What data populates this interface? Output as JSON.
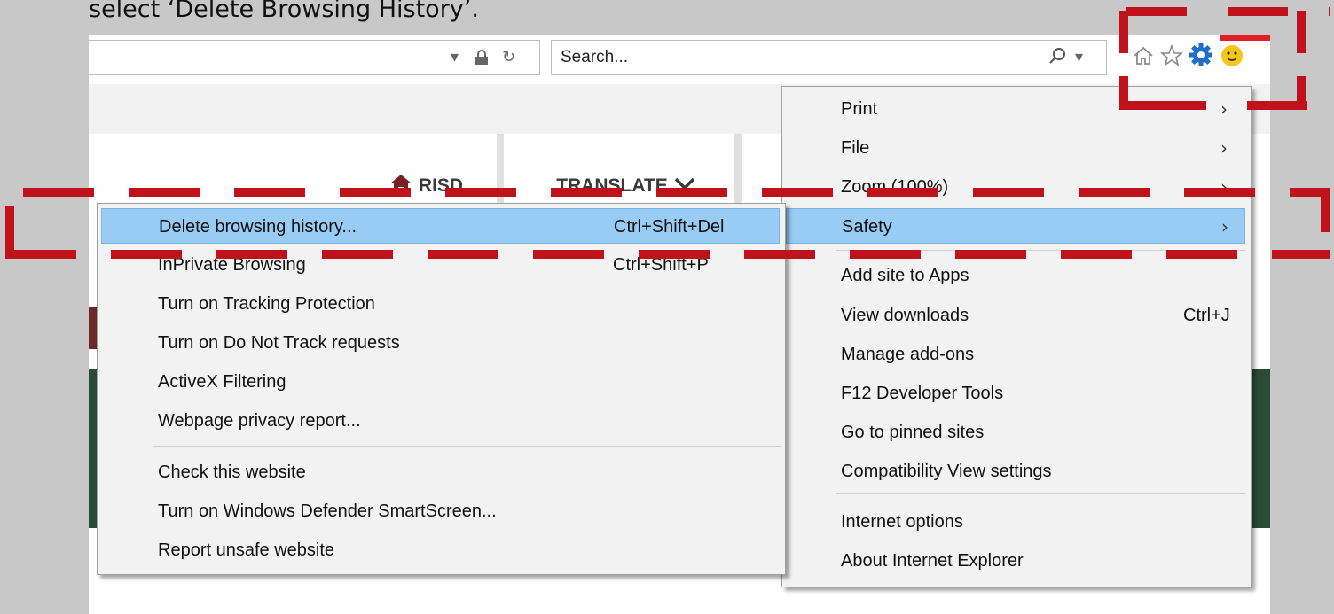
{
  "caption": "select ‘Delete Browsing History’.",
  "address_bar": {
    "dropdown_glyph": "▾",
    "lock_glyph": "🔒",
    "refresh_glyph": "↻"
  },
  "search": {
    "placeholder": "Search...",
    "search_glyph": "⌕",
    "dropdown_glyph": "▾"
  },
  "toolbar_icons": {
    "home": "home-icon",
    "favorites": "star-icon",
    "tools": "gear-icon",
    "feedback": "smiley-icon"
  },
  "site_nav": {
    "home_label": "RISD",
    "translate_label": "TRANSLATE"
  },
  "tools_menu": {
    "items": [
      {
        "label": "Print",
        "shortcut": "",
        "submenu": true
      },
      {
        "label": "File",
        "shortcut": "",
        "submenu": true
      },
      {
        "label": "Zoom (100%)",
        "shortcut": "",
        "submenu": true
      },
      {
        "label": "Safety",
        "shortcut": "",
        "submenu": true,
        "highlighted": true
      },
      {
        "label": "Add site to Apps",
        "shortcut": "",
        "submenu": false
      },
      {
        "label": "View downloads",
        "shortcut": "Ctrl+J",
        "submenu": false
      },
      {
        "label": "Manage add-ons",
        "shortcut": "",
        "submenu": false
      },
      {
        "label": "F12 Developer Tools",
        "shortcut": "",
        "submenu": false
      },
      {
        "label": "Go to pinned sites",
        "shortcut": "",
        "submenu": false
      },
      {
        "label": "Compatibility View settings",
        "shortcut": "",
        "submenu": false
      },
      {
        "label": "Internet options",
        "shortcut": "",
        "submenu": false
      },
      {
        "label": "About Internet Explorer",
        "shortcut": "",
        "submenu": false
      }
    ]
  },
  "safety_menu": {
    "items": [
      {
        "label": "Delete browsing history...",
        "shortcut": "Ctrl+Shift+Del",
        "highlighted": true
      },
      {
        "label": "InPrivate Browsing",
        "shortcut": "Ctrl+Shift+P"
      },
      {
        "label": "Turn on Tracking Protection",
        "shortcut": ""
      },
      {
        "label": "Turn on Do Not Track requests",
        "shortcut": ""
      },
      {
        "label": "ActiveX Filtering",
        "shortcut": ""
      },
      {
        "label": "Webpage privacy report...",
        "shortcut": ""
      },
      {
        "label": "Check this website",
        "shortcut": ""
      },
      {
        "label": "Turn on Windows Defender SmartScreen...",
        "shortcut": ""
      },
      {
        "label": "Report unsafe website",
        "shortcut": ""
      }
    ]
  },
  "colors": {
    "highlight": "#99ccf5",
    "annotation": "#c0121b",
    "site_band": "#2c4a38",
    "menu_bg": "#f2f2f2"
  }
}
